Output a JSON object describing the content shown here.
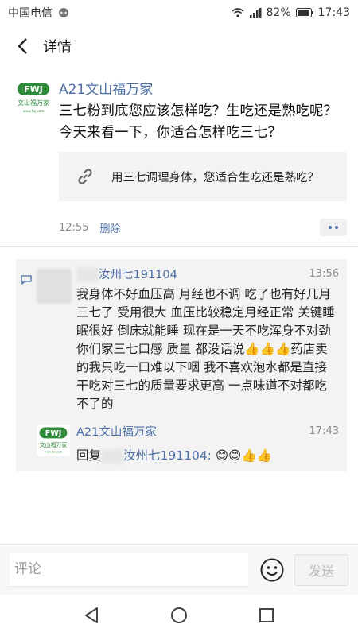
{
  "status_bar": {
    "carrier": "中国电信",
    "battery": "82%",
    "time": "17:43"
  },
  "nav": {
    "title": "详情"
  },
  "post": {
    "author": "A21文山福万家",
    "avatar_logo_text": "FWJ 文山福万家 www.fwj.com",
    "text": "三七粉到底您应该怎样吃？生吃还是熟吃呢？今天来看一下，你适合怎样吃三七？",
    "link_title": "用三七调理身体，您适合生吃还是熟吃？",
    "time": "12:55",
    "delete_label": "删除"
  },
  "comments": [
    {
      "author": "汝州七191104",
      "time": "13:56",
      "text": "我身体不好血压高 月经也不调 吃了也有好几月三七了 受用很大 血压比较稳定月经正常 关键睡眠很好 倒床就能睡 现在是一天不吃浑身不对劲 你们家三七口感 质量 都没话说👍👍👍药店卖的我只吃一口难以下咽 我不喜欢泡水都是直接干吃对三七的质量要求更高 一点味道不对都吃不了的"
    }
  ],
  "reply": {
    "author": "A21文山福万家",
    "time": "17:43",
    "prefix": "回复",
    "target": "汝州七191104:",
    "content": "😊😊👍👍"
  },
  "input": {
    "placeholder": "评论",
    "send_label": "发送"
  },
  "colors": {
    "link_blue": "#4a6ea8",
    "logo_green": "#2e8b3a"
  }
}
